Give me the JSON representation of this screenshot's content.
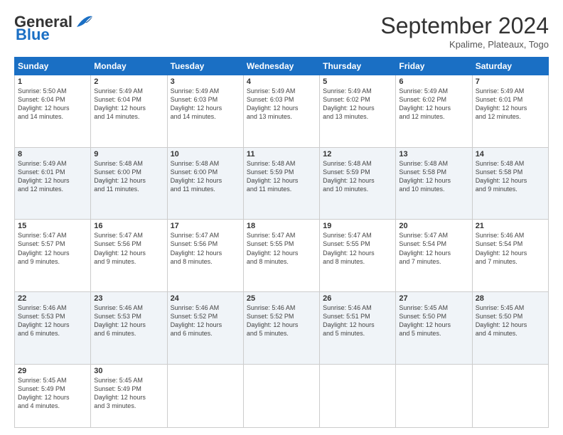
{
  "header": {
    "logo_general": "General",
    "logo_blue": "Blue",
    "month": "September 2024",
    "location": "Kpalime, Plateaux, Togo"
  },
  "weekdays": [
    "Sunday",
    "Monday",
    "Tuesday",
    "Wednesday",
    "Thursday",
    "Friday",
    "Saturday"
  ],
  "weeks": [
    [
      {
        "day": "1",
        "info": "Sunrise: 5:50 AM\nSunset: 6:04 PM\nDaylight: 12 hours\nand 14 minutes."
      },
      {
        "day": "2",
        "info": "Sunrise: 5:49 AM\nSunset: 6:04 PM\nDaylight: 12 hours\nand 14 minutes."
      },
      {
        "day": "3",
        "info": "Sunrise: 5:49 AM\nSunset: 6:03 PM\nDaylight: 12 hours\nand 14 minutes."
      },
      {
        "day": "4",
        "info": "Sunrise: 5:49 AM\nSunset: 6:03 PM\nDaylight: 12 hours\nand 13 minutes."
      },
      {
        "day": "5",
        "info": "Sunrise: 5:49 AM\nSunset: 6:02 PM\nDaylight: 12 hours\nand 13 minutes."
      },
      {
        "day": "6",
        "info": "Sunrise: 5:49 AM\nSunset: 6:02 PM\nDaylight: 12 hours\nand 12 minutes."
      },
      {
        "day": "7",
        "info": "Sunrise: 5:49 AM\nSunset: 6:01 PM\nDaylight: 12 hours\nand 12 minutes."
      }
    ],
    [
      {
        "day": "8",
        "info": "Sunrise: 5:49 AM\nSunset: 6:01 PM\nDaylight: 12 hours\nand 12 minutes."
      },
      {
        "day": "9",
        "info": "Sunrise: 5:48 AM\nSunset: 6:00 PM\nDaylight: 12 hours\nand 11 minutes."
      },
      {
        "day": "10",
        "info": "Sunrise: 5:48 AM\nSunset: 6:00 PM\nDaylight: 12 hours\nand 11 minutes."
      },
      {
        "day": "11",
        "info": "Sunrise: 5:48 AM\nSunset: 5:59 PM\nDaylight: 12 hours\nand 11 minutes."
      },
      {
        "day": "12",
        "info": "Sunrise: 5:48 AM\nSunset: 5:59 PM\nDaylight: 12 hours\nand 10 minutes."
      },
      {
        "day": "13",
        "info": "Sunrise: 5:48 AM\nSunset: 5:58 PM\nDaylight: 12 hours\nand 10 minutes."
      },
      {
        "day": "14",
        "info": "Sunrise: 5:48 AM\nSunset: 5:58 PM\nDaylight: 12 hours\nand 9 minutes."
      }
    ],
    [
      {
        "day": "15",
        "info": "Sunrise: 5:47 AM\nSunset: 5:57 PM\nDaylight: 12 hours\nand 9 minutes."
      },
      {
        "day": "16",
        "info": "Sunrise: 5:47 AM\nSunset: 5:56 PM\nDaylight: 12 hours\nand 9 minutes."
      },
      {
        "day": "17",
        "info": "Sunrise: 5:47 AM\nSunset: 5:56 PM\nDaylight: 12 hours\nand 8 minutes."
      },
      {
        "day": "18",
        "info": "Sunrise: 5:47 AM\nSunset: 5:55 PM\nDaylight: 12 hours\nand 8 minutes."
      },
      {
        "day": "19",
        "info": "Sunrise: 5:47 AM\nSunset: 5:55 PM\nDaylight: 12 hours\nand 8 minutes."
      },
      {
        "day": "20",
        "info": "Sunrise: 5:47 AM\nSunset: 5:54 PM\nDaylight: 12 hours\nand 7 minutes."
      },
      {
        "day": "21",
        "info": "Sunrise: 5:46 AM\nSunset: 5:54 PM\nDaylight: 12 hours\nand 7 minutes."
      }
    ],
    [
      {
        "day": "22",
        "info": "Sunrise: 5:46 AM\nSunset: 5:53 PM\nDaylight: 12 hours\nand 6 minutes."
      },
      {
        "day": "23",
        "info": "Sunrise: 5:46 AM\nSunset: 5:53 PM\nDaylight: 12 hours\nand 6 minutes."
      },
      {
        "day": "24",
        "info": "Sunrise: 5:46 AM\nSunset: 5:52 PM\nDaylight: 12 hours\nand 6 minutes."
      },
      {
        "day": "25",
        "info": "Sunrise: 5:46 AM\nSunset: 5:52 PM\nDaylight: 12 hours\nand 5 minutes."
      },
      {
        "day": "26",
        "info": "Sunrise: 5:46 AM\nSunset: 5:51 PM\nDaylight: 12 hours\nand 5 minutes."
      },
      {
        "day": "27",
        "info": "Sunrise: 5:45 AM\nSunset: 5:50 PM\nDaylight: 12 hours\nand 5 minutes."
      },
      {
        "day": "28",
        "info": "Sunrise: 5:45 AM\nSunset: 5:50 PM\nDaylight: 12 hours\nand 4 minutes."
      }
    ],
    [
      {
        "day": "29",
        "info": "Sunrise: 5:45 AM\nSunset: 5:49 PM\nDaylight: 12 hours\nand 4 minutes."
      },
      {
        "day": "30",
        "info": "Sunrise: 5:45 AM\nSunset: 5:49 PM\nDaylight: 12 hours\nand 3 minutes."
      },
      {
        "day": "",
        "info": ""
      },
      {
        "day": "",
        "info": ""
      },
      {
        "day": "",
        "info": ""
      },
      {
        "day": "",
        "info": ""
      },
      {
        "day": "",
        "info": ""
      }
    ]
  ]
}
